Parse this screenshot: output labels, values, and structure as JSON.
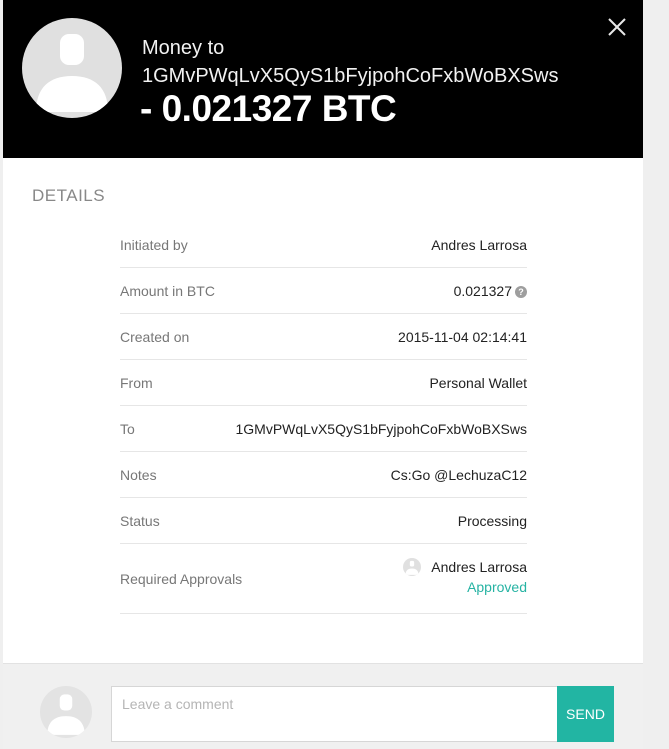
{
  "header": {
    "title_prefix": "Money to",
    "address": "1GMvPWqLvX5QyS1bFyjpohCoFxbWoBXSws",
    "amount": "- 0.021327 BTC"
  },
  "section_title": "DETAILS",
  "details": [
    {
      "label": "Initiated by",
      "value": "Andres Larrosa"
    },
    {
      "label": "Amount in BTC",
      "value": "0.021327"
    },
    {
      "label": "Created on",
      "value": "2015-11-04 02:14:41"
    },
    {
      "label": "From",
      "value": "Personal Wallet"
    },
    {
      "label": "To",
      "value": "1GMvPWqLvX5QyS1bFyjpohCoFxbWoBXSws"
    },
    {
      "label": "Notes",
      "value": "Cs:Go @LechuzaC12"
    },
    {
      "label": "Status",
      "value": "Processing"
    }
  ],
  "approvals": {
    "label": "Required Approvals",
    "approver": "Andres Larrosa",
    "state": "Approved"
  },
  "help_glyph": "?",
  "comment": {
    "placeholder": "Leave a comment",
    "value": "",
    "send_label": "SEND"
  },
  "colors": {
    "header_bg": "#000000",
    "accent": "#22b5a3"
  },
  "icons": {
    "close": "close-icon",
    "avatar": "user-silhouette-icon",
    "help": "help-icon"
  }
}
